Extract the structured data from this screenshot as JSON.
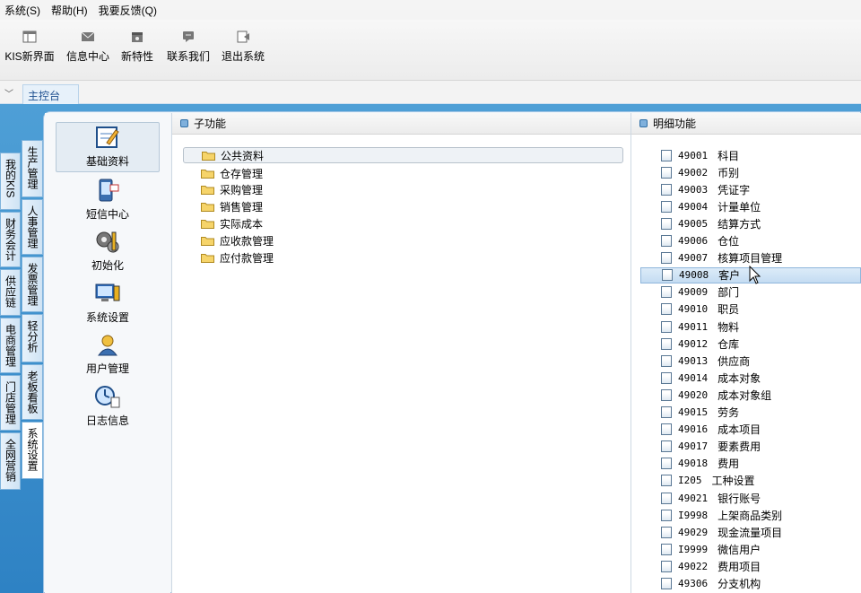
{
  "menu": [
    "系统(S)",
    "帮助(H)",
    "我要反馈(Q)"
  ],
  "toolbar": [
    {
      "label": "KIS新界面",
      "icon": "layout-icon"
    },
    {
      "label": "信息中心",
      "icon": "mail-icon"
    },
    {
      "label": "新特性",
      "icon": "star-box-icon"
    },
    {
      "label": "联系我们",
      "icon": "chat-icon"
    },
    {
      "label": "退出系统",
      "icon": "exit-icon"
    }
  ],
  "tabbar": {
    "active_tab": "主控台"
  },
  "side_tabs_left": [
    "我的KIS",
    "财务会计",
    "供应链",
    "电商管理",
    "门店管理",
    "全网营销"
  ],
  "side_tabs_right": [
    "生产管理",
    "人事管理",
    "发票管理",
    "轻分析",
    "老板看板",
    "系统设置"
  ],
  "modules": [
    "基础资料",
    "短信中心",
    "初始化",
    "系统设置",
    "用户管理",
    "日志信息"
  ],
  "subfunc": {
    "header": "子功能",
    "items": [
      "公共资料",
      "仓存管理",
      "采购管理",
      "销售管理",
      "实际成本",
      "应收款管理",
      "应付款管理"
    ]
  },
  "detail": {
    "header": "明细功能",
    "items": [
      {
        "code": "49001",
        "name": "科目"
      },
      {
        "code": "49002",
        "name": "币别"
      },
      {
        "code": "49003",
        "name": "凭证字"
      },
      {
        "code": "49004",
        "name": "计量单位"
      },
      {
        "code": "49005",
        "name": "结算方式"
      },
      {
        "code": "49006",
        "name": "仓位"
      },
      {
        "code": "49007",
        "name": "核算项目管理"
      },
      {
        "code": "49008",
        "name": "客户"
      },
      {
        "code": "49009",
        "name": "部门"
      },
      {
        "code": "49010",
        "name": "职员"
      },
      {
        "code": "49011",
        "name": "物料"
      },
      {
        "code": "49012",
        "name": "仓库"
      },
      {
        "code": "49013",
        "name": "供应商"
      },
      {
        "code": "49014",
        "name": "成本对象"
      },
      {
        "code": "49020",
        "name": "成本对象组"
      },
      {
        "code": "49015",
        "name": "劳务"
      },
      {
        "code": "49016",
        "name": "成本项目"
      },
      {
        "code": "49017",
        "name": "要素费用"
      },
      {
        "code": "49018",
        "name": "费用"
      },
      {
        "code": "I205",
        "name": "工种设置"
      },
      {
        "code": "49021",
        "name": "银行账号"
      },
      {
        "code": "I9998",
        "name": "上架商品类别"
      },
      {
        "code": "49029",
        "name": "现金流量项目"
      },
      {
        "code": "I9999",
        "name": "微信用户"
      },
      {
        "code": "49022",
        "name": "费用项目"
      },
      {
        "code": "49306",
        "name": "分支机构"
      }
    ]
  }
}
